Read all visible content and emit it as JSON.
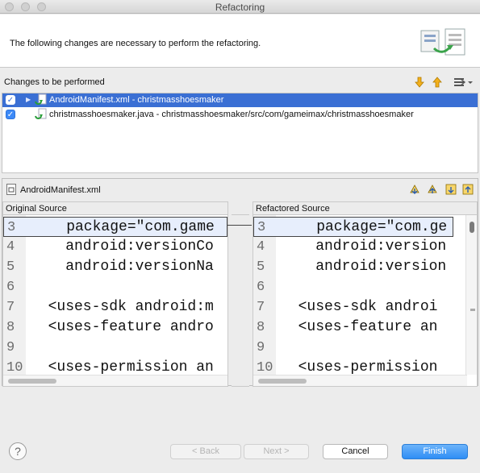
{
  "window": {
    "title": "Refactoring"
  },
  "header": {
    "message": "The following changes are necessary to perform the refactoring."
  },
  "changes": {
    "label": "Changes to be performed",
    "items": [
      {
        "label": "AndroidManifest.xml - christmasshoesmaker",
        "checked": true,
        "selected": true
      },
      {
        "label": "christmasshoesmaker.java - christmasshoesmaker/src/com/gameimax/christmasshoesmaker",
        "checked": true,
        "selected": false
      }
    ]
  },
  "preview": {
    "file_label": "AndroidManifest.xml",
    "original_label": "Original Source",
    "refactored_label": "Refactored Source",
    "original_lines": [
      {
        "num": "3",
        "text": "    package=\"com.game"
      },
      {
        "num": "4",
        "text": "    android:versionCo"
      },
      {
        "num": "5",
        "text": "    android:versionNa"
      },
      {
        "num": "6",
        "text": ""
      },
      {
        "num": "7",
        "text": "  <uses-sdk android:m"
      },
      {
        "num": "8",
        "text": "  <uses-feature andro"
      },
      {
        "num": "9",
        "text": ""
      },
      {
        "num": "10",
        "text": "  <uses-permission an"
      }
    ],
    "refactored_lines": [
      {
        "num": "3",
        "text": "    package=\"com.ge"
      },
      {
        "num": "4",
        "text": "    android:version"
      },
      {
        "num": "5",
        "text": "    android:version"
      },
      {
        "num": "6",
        "text": ""
      },
      {
        "num": "7",
        "text": "  <uses-sdk androi"
      },
      {
        "num": "8",
        "text": "  <uses-feature an"
      },
      {
        "num": "9",
        "text": ""
      },
      {
        "num": "10",
        "text": "  <uses-permission"
      }
    ]
  },
  "buttons": {
    "help": "?",
    "back": "< Back",
    "next": "Next >",
    "cancel": "Cancel",
    "finish": "Finish"
  },
  "colors": {
    "selection": "#3a6fd4",
    "primary": "#2f8ef5",
    "checkbox": "#3d8af7"
  }
}
